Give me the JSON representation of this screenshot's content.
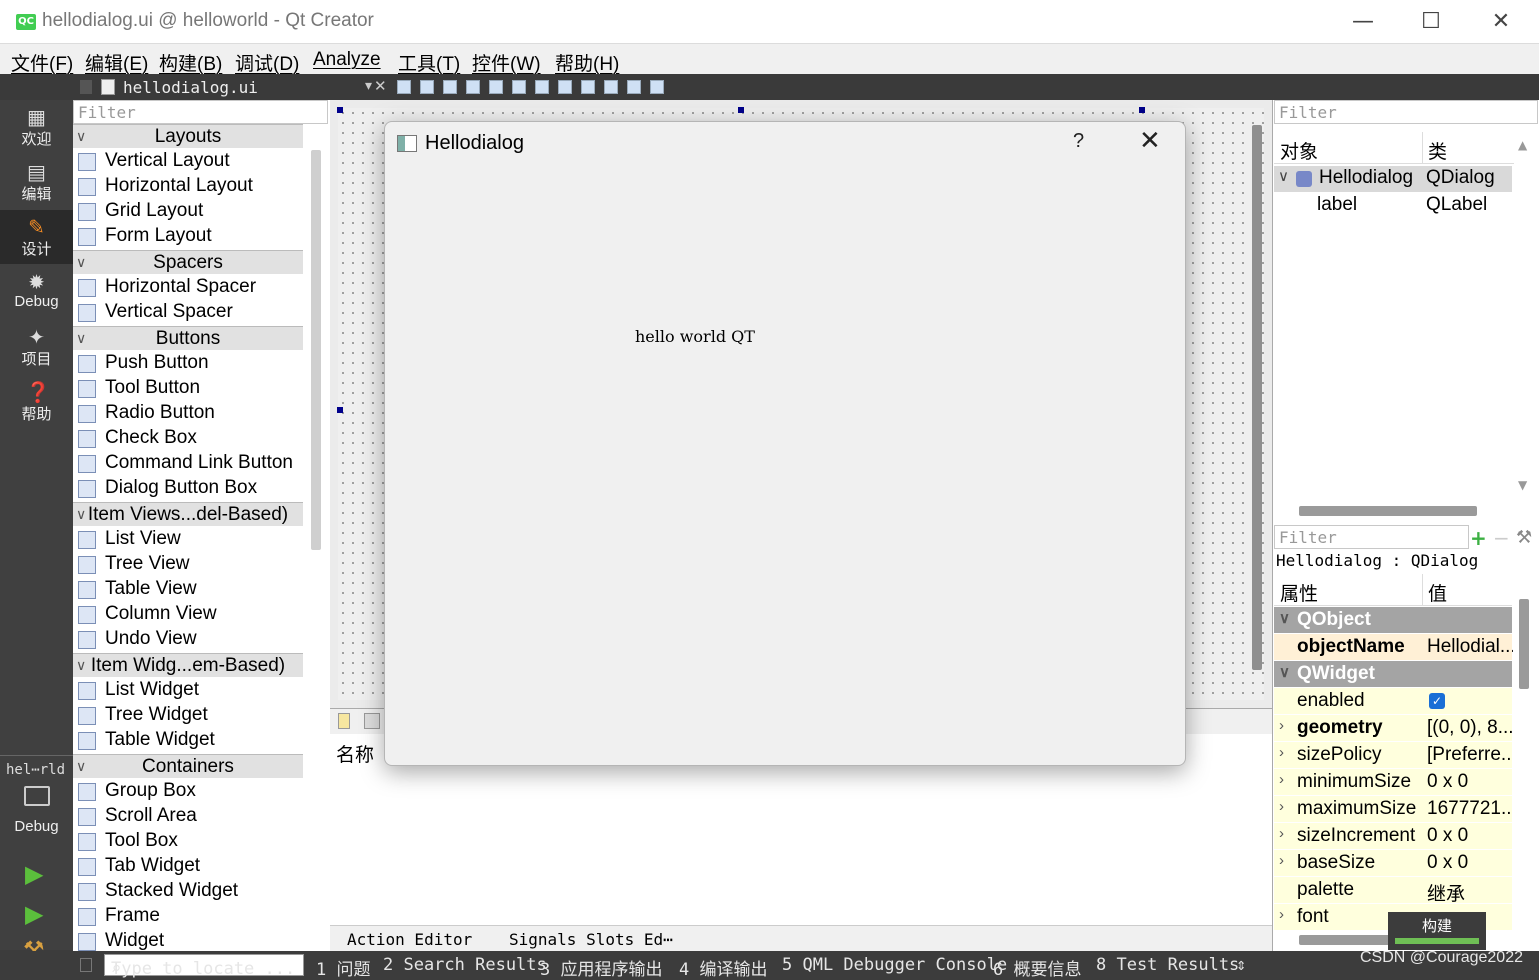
{
  "window": {
    "title": "hellodialog.ui @ helloworld - Qt Creator",
    "logo": "QC",
    "minimize": "—",
    "maximize": "☐",
    "close": "✕"
  },
  "menu": [
    "文件(F)",
    "编辑(E)",
    "构建(B)",
    "调试(D)",
    "Analyze",
    "工具(T)",
    "控件(W)",
    "帮助(H)"
  ],
  "editor_tab": {
    "filename": "hellodialog.ui",
    "close": "✕"
  },
  "modes": [
    {
      "label": "欢迎",
      "icon": "grid-icon"
    },
    {
      "label": "编辑",
      "icon": "document-icon"
    },
    {
      "label": "设计",
      "icon": "pencil-icon",
      "active": true
    },
    {
      "label": "Debug",
      "icon": "bug-icon"
    },
    {
      "label": "项目",
      "icon": "wrench-icon"
    },
    {
      "label": "帮助",
      "icon": "help-icon"
    }
  ],
  "kit": {
    "project": "hel⋯rld",
    "label": "Debug"
  },
  "widgetbox": {
    "filter_placeholder": "Filter",
    "categories": [
      {
        "name": "Layouts",
        "items": [
          "Vertical Layout",
          "Horizontal Layout",
          "Grid Layout",
          "Form Layout"
        ]
      },
      {
        "name": "Spacers",
        "items": [
          "Horizontal Spacer",
          "Vertical Spacer"
        ]
      },
      {
        "name": "Buttons",
        "items": [
          "Push Button",
          "Tool Button",
          "Radio Button",
          "Check Box",
          "Command Link Button",
          "Dialog Button Box"
        ]
      },
      {
        "name": "Item Views...del-Based)",
        "items": [
          "List View",
          "Tree View",
          "Table View",
          "Column View",
          "Undo View"
        ]
      },
      {
        "name": "Item Widg...em-Based)",
        "items": [
          "List Widget",
          "Tree Widget",
          "Table Widget"
        ]
      },
      {
        "name": "Containers",
        "items": [
          "Group Box",
          "Scroll Area",
          "Tool Box",
          "Tab Widget",
          "Stacked Widget",
          "Frame",
          "Widget"
        ]
      }
    ]
  },
  "dialog": {
    "title": "Hellodialog",
    "help": "?",
    "close": "✕",
    "label_text": "hello world QT"
  },
  "action_editor": {
    "name_column": "名称"
  },
  "bottom_tabs": [
    "Action Editor",
    "Signals  Slots Ed⋯"
  ],
  "object_inspector": {
    "filter_placeholder": "Filter",
    "col_object": "对象",
    "col_class": "类",
    "rows": [
      {
        "object": "Hellodialog",
        "class": "QDialog"
      },
      {
        "object": "label",
        "class": "QLabel"
      }
    ]
  },
  "property_editor": {
    "filter_placeholder": "Filter",
    "context": "Hellodialog : QDialog",
    "col_property": "属性",
    "col_value": "值",
    "rows": [
      {
        "name": "QObject",
        "value": "",
        "type": "section"
      },
      {
        "name": "objectName",
        "value": "Hellodial...",
        "type": "peach"
      },
      {
        "name": "QWidget",
        "value": "",
        "type": "section"
      },
      {
        "name": "enabled",
        "value": "",
        "type": "yellow"
      },
      {
        "name": "geometry",
        "value": "[(0, 0), 8...",
        "type": "yellow"
      },
      {
        "name": "sizePolicy",
        "value": "[Preferre...",
        "type": "yellow"
      },
      {
        "name": "minimumSize",
        "value": "0 x 0",
        "type": "yellow"
      },
      {
        "name": "maximumSize",
        "value": "1677721...",
        "type": "yellow"
      },
      {
        "name": "sizeIncrement",
        "value": "0 x 0",
        "type": "yellow"
      },
      {
        "name": "baseSize",
        "value": "0 x 0",
        "type": "yellow"
      },
      {
        "name": "palette",
        "value": "继承",
        "type": "yellow"
      },
      {
        "name": "font",
        "value": "",
        "type": "yellow"
      }
    ]
  },
  "build_popup": "构建",
  "statusbar": {
    "locate_placeholder": "Type to locate ...",
    "items": [
      "1 问题",
      "2 Search Results",
      "3 应用程序输出",
      "4 编译输出",
      "5 QML Debugger Console",
      "6 概要信息",
      "8 Test Results"
    ],
    "arrows": "⇕"
  },
  "watermark": "CSDN @Courage2022"
}
